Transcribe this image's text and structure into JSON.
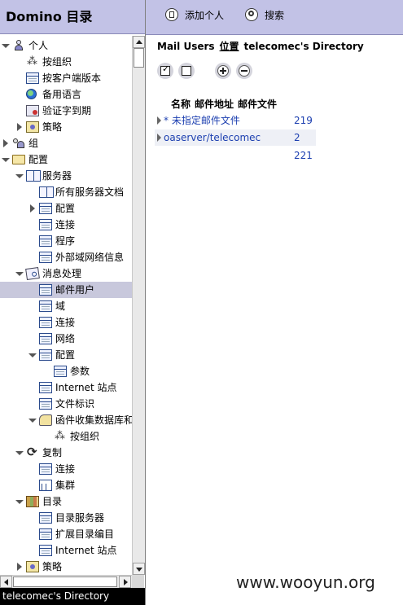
{
  "navigator": {
    "title": "Domino 目录",
    "status_text": "telecomec's Directory",
    "tree": [
      {
        "label": "个人",
        "icon": "person-icon",
        "level": 0,
        "twisty": "open"
      },
      {
        "label": "按组织",
        "icon": "hierarchy-icon",
        "level": 1,
        "twisty": "none"
      },
      {
        "label": "按客户端版本",
        "icon": "view-icon",
        "level": 1,
        "twisty": "none"
      },
      {
        "label": "备用语言",
        "icon": "globe-icon",
        "level": 1,
        "twisty": "none"
      },
      {
        "label": "验证字到期",
        "icon": "certificate-icon",
        "level": 1,
        "twisty": "none"
      },
      {
        "label": "策略",
        "icon": "policy-icon",
        "level": 1,
        "twisty": "closed"
      },
      {
        "label": "组",
        "icon": "group-icon",
        "level": 0,
        "twisty": "closed"
      },
      {
        "label": "配置",
        "icon": "folder-icon",
        "level": 0,
        "twisty": "open"
      },
      {
        "label": "服务器",
        "icon": "book-icon",
        "level": 1,
        "twisty": "open"
      },
      {
        "label": "所有服务器文档",
        "icon": "book-icon",
        "level": 2,
        "twisty": "none"
      },
      {
        "label": "配置",
        "icon": "view-icon",
        "level": 2,
        "twisty": "closed"
      },
      {
        "label": "连接",
        "icon": "view-icon",
        "level": 2,
        "twisty": "none"
      },
      {
        "label": "程序",
        "icon": "view-icon",
        "level": 2,
        "twisty": "none"
      },
      {
        "label": "外部域网络信息",
        "icon": "view-icon",
        "level": 2,
        "twisty": "none"
      },
      {
        "label": "消息处理",
        "icon": "messaging-icon",
        "level": 1,
        "twisty": "open"
      },
      {
        "label": "邮件用户",
        "icon": "view-icon",
        "level": 2,
        "twisty": "none",
        "selected": true
      },
      {
        "label": "域",
        "icon": "view-icon",
        "level": 2,
        "twisty": "none"
      },
      {
        "label": "连接",
        "icon": "view-icon",
        "level": 2,
        "twisty": "none"
      },
      {
        "label": "网络",
        "icon": "view-icon",
        "level": 2,
        "twisty": "none"
      },
      {
        "label": "配置",
        "icon": "view-icon",
        "level": 2,
        "twisty": "open"
      },
      {
        "label": "参数",
        "icon": "view-icon",
        "level": 3,
        "twisty": "none"
      },
      {
        "label": "Internet 站点",
        "icon": "view-icon",
        "level": 2,
        "twisty": "none"
      },
      {
        "label": "文件标识",
        "icon": "view-icon",
        "level": 2,
        "twisty": "none"
      },
      {
        "label": "函件收集数据库和",
        "icon": "collection-icon",
        "level": 2,
        "twisty": "open"
      },
      {
        "label": "按组织",
        "icon": "hierarchy-icon",
        "level": 3,
        "twisty": "none"
      },
      {
        "label": "复制",
        "icon": "replication-icon",
        "level": 1,
        "twisty": "open"
      },
      {
        "label": "连接",
        "icon": "view-icon",
        "level": 2,
        "twisty": "none"
      },
      {
        "label": "集群",
        "icon": "cluster-icon",
        "level": 2,
        "twisty": "none"
      },
      {
        "label": "目录",
        "icon": "directory-icon",
        "level": 1,
        "twisty": "open"
      },
      {
        "label": "目录服务器",
        "icon": "view-icon",
        "level": 2,
        "twisty": "none"
      },
      {
        "label": "扩展目录编目",
        "icon": "view-icon",
        "level": 2,
        "twisty": "none"
      },
      {
        "label": "Internet 站点",
        "icon": "view-icon",
        "level": 2,
        "twisty": "none"
      },
      {
        "label": "策略",
        "icon": "policy-icon",
        "level": 1,
        "twisty": "closed"
      }
    ]
  },
  "toolbar": {
    "add_person_label": "添加个人",
    "add_person_icon": "document-icon",
    "search_label": "搜索",
    "search_icon": "search-icon"
  },
  "view": {
    "breadcrumb": [
      "Mail Users",
      "位置",
      "telecomec's Directory"
    ],
    "columns": [
      "名称",
      "邮件地址",
      "邮件文件"
    ],
    "rows": [
      {
        "category": "* 未指定邮件文件",
        "count": "219"
      },
      {
        "category": "oaserver/telecomec",
        "count": "2"
      }
    ],
    "total": "221"
  },
  "watermark": "www.wooyun.org",
  "colors": {
    "header_bg": "#c2c2e6",
    "selected_row": "#c8c8dc",
    "link_text": "#1c3fb0",
    "status_bar": "#000000"
  }
}
